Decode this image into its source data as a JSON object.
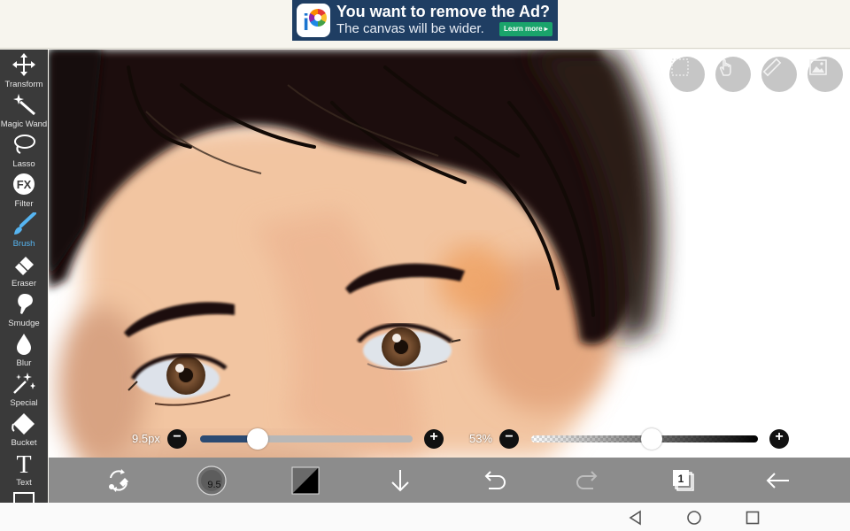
{
  "ad": {
    "headline": "You want to remove the Ad?",
    "subtext": "The canvas will be wider.",
    "cta": "Learn more ▸"
  },
  "tools": [
    {
      "label": "Transform",
      "icon": "transform-icon"
    },
    {
      "label": "Magic Wand",
      "icon": "magic-wand-icon"
    },
    {
      "label": "Lasso",
      "icon": "lasso-icon"
    },
    {
      "label": "Filter",
      "icon": "fx-filter-icon"
    },
    {
      "label": "Brush",
      "icon": "brush-icon",
      "active": true
    },
    {
      "label": "Eraser",
      "icon": "eraser-icon"
    },
    {
      "label": "Smudge",
      "icon": "smudge-icon"
    },
    {
      "label": "Blur",
      "icon": "blur-drop-icon"
    },
    {
      "label": "Special",
      "icon": "special-sparkle-icon"
    },
    {
      "label": "Bucket",
      "icon": "bucket-icon"
    },
    {
      "label": "Text",
      "icon": "text-icon"
    }
  ],
  "canvas_buttons": [
    "grid-icon",
    "hand-gesture-icon",
    "ruler-icon",
    "material-image-icon"
  ],
  "brush_size": {
    "label": "9.5px",
    "value_fraction": 0.27
  },
  "opacity": {
    "label": "53%",
    "value_fraction": 0.53
  },
  "action_bar": {
    "brush_badge": "9.5",
    "layers_count": "1",
    "icons": [
      "swap-brush-eraser-icon",
      "brush-preview-icon",
      "color-swatch-icon",
      "download-icon",
      "undo-icon",
      "redo-icon",
      "layers-icon",
      "back-arrow-icon"
    ]
  },
  "nav": [
    "back-triangle-icon",
    "home-circle-icon",
    "recents-square-icon"
  ],
  "colors": {
    "toolbar_bg": "#3a3a3a",
    "active_tool": "#56b4f0",
    "action_bar": "#8c8c8c",
    "ad_bg": "#1f3e63",
    "ad_cta": "#1aa46b"
  }
}
